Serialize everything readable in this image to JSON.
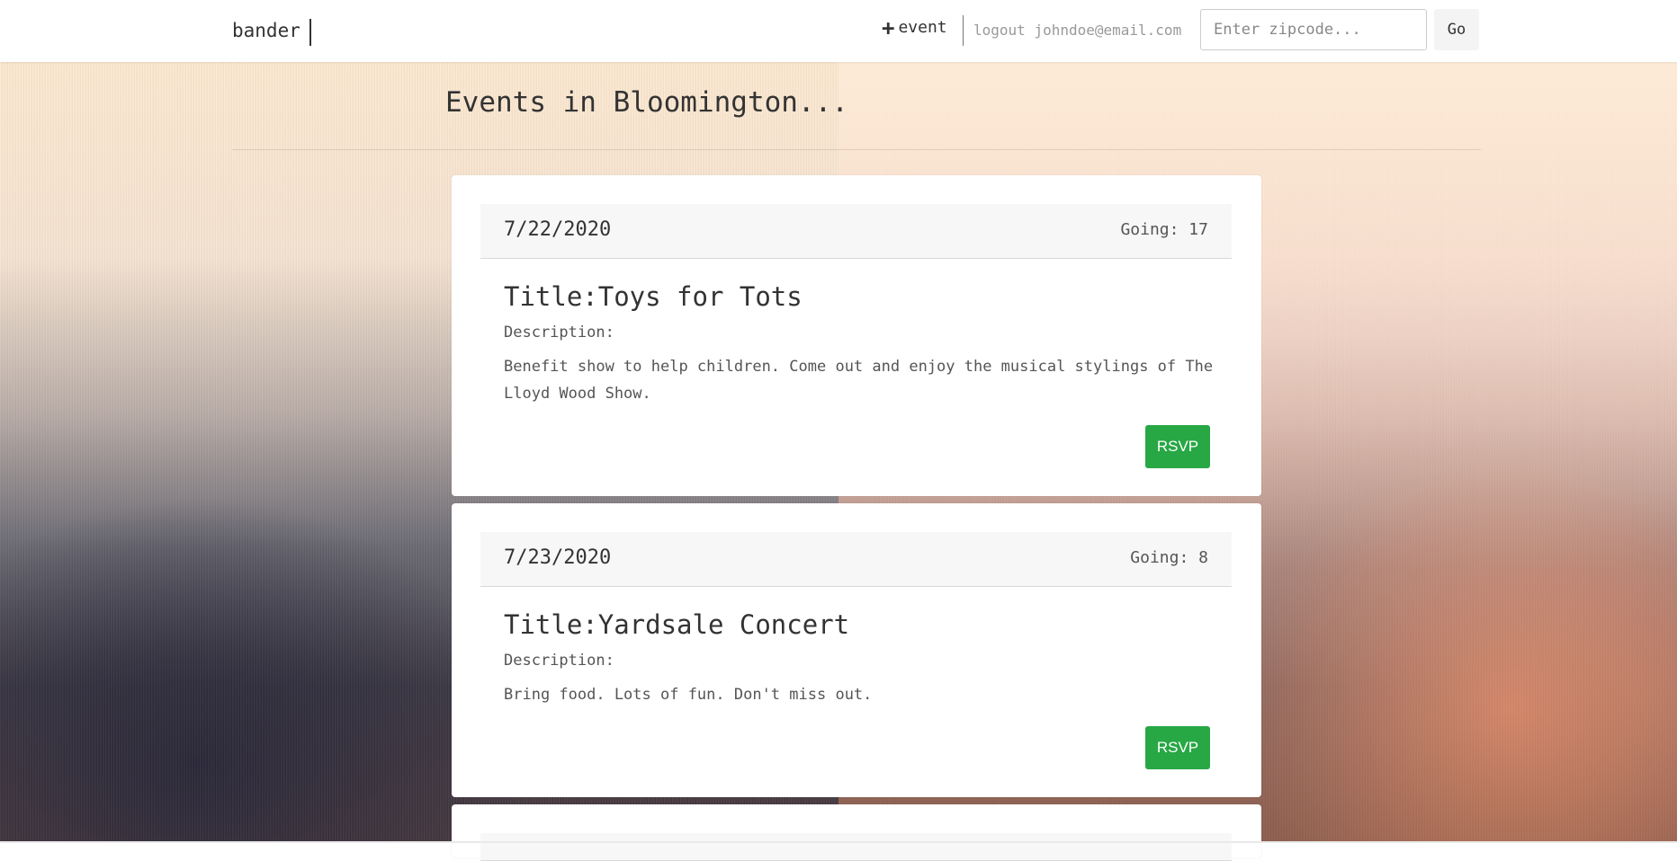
{
  "navbar": {
    "brand": "bander",
    "add_event_label": "event",
    "add_event_icon": "plus-icon",
    "logout_label": "logout",
    "user_email": "johndoe@email.com",
    "zip_placeholder": "Enter zipcode...",
    "go_label": "Go"
  },
  "page": {
    "title": "Events in Bloomington..."
  },
  "events": [
    {
      "date": "7/22/2020",
      "going": "Going: 17",
      "title": "Title:Toys for Tots",
      "description_label": "Description:",
      "description": "Benefit show to help children. Come out and enjoy the musical stylings of The Lloyd Wood Show.",
      "rsvp_label": "RSVP"
    },
    {
      "date": "7/23/2020",
      "going": "Going: 8",
      "title": "Title:Yardsale Concert",
      "description_label": "Description:",
      "description": "Bring food. Lots of fun. Don't miss out.",
      "rsvp_label": "RSVP"
    }
  ],
  "colors": {
    "rsvp_button": "#28a745",
    "card_header": "#f7f7f7"
  }
}
